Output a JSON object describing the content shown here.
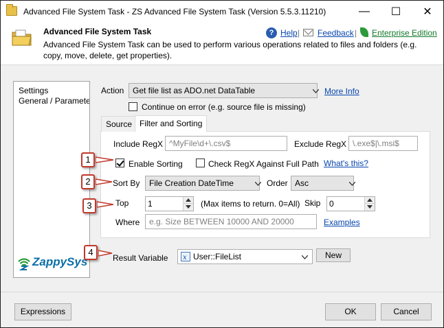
{
  "window": {
    "title": "Advanced File System Task - ZS Advanced File System Task (Version 5.5.3.11210)",
    "minimize_glyph": "—",
    "maximize_glyph": "☐",
    "close_glyph": "✕"
  },
  "header": {
    "title": "Advanced File System Task",
    "description": "Advanced File System Task can be used to perform various operations related to files and folders (e.g. copy, move, delete, get properties).",
    "help_label": "Help",
    "feedback_label": "Feedback",
    "edition_label": "Enterprise Edition",
    "separator": "|"
  },
  "sidebar": {
    "items": [
      {
        "label": "Settings"
      },
      {
        "label": "General / Paramete"
      }
    ]
  },
  "logo": {
    "text": "ZappySys"
  },
  "form": {
    "action_label": "Action",
    "action_value": "Get file list as ADO.net DataTable",
    "more_info": "More Info",
    "continue_on_error_label": "Continue on error (e.g. source file is missing)",
    "continue_on_error_checked": false,
    "tabs": [
      {
        "label": "Source"
      },
      {
        "label": "Filter and Sorting"
      }
    ],
    "include_regx_label": "Include RegX",
    "include_regx_placeholder": "^MyFile\\d+\\.csv$",
    "exclude_regx_label": "Exclude RegX",
    "exclude_regx_placeholder": "\\.exe$|\\.msi$",
    "enable_sorting_label": "Enable Sorting",
    "enable_sorting_checked": true,
    "check_regx_label": "Check RegX Against Full Path",
    "check_regx_checked": false,
    "whats_this": "What's this?",
    "sort_by_label": "Sort By",
    "sort_by_value": "File Creation DateTime",
    "order_label": "Order",
    "order_value": "Asc",
    "top_label": "Top",
    "top_value": "1",
    "top_hint": "(Max items to return. 0=All)",
    "skip_label": "Skip",
    "skip_value": "0",
    "where_label": "Where",
    "where_placeholder": "e.g. Size BETWEEN 10000 AND 20000",
    "examples_link": "Examples",
    "result_variable_label": "Result Variable",
    "result_variable_value": "User::FileList",
    "new_button": "New"
  },
  "callouts": [
    "1",
    "2",
    "3",
    "4"
  ],
  "footer": {
    "expressions_button": "Expressions",
    "ok_button": "OK",
    "cancel_button": "Cancel"
  },
  "colors": {
    "link": "#0645ad",
    "enterprise": "#127a2a",
    "callout_border": "#c0392b",
    "logo": "#0b6fa8"
  }
}
